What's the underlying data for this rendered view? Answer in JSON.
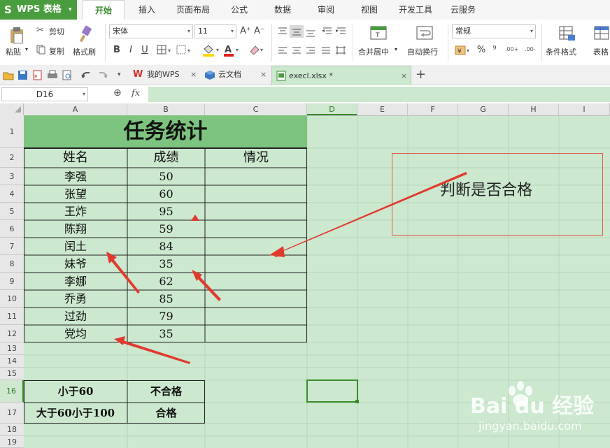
{
  "app": {
    "logo_glyph": "S",
    "name": "WPS 表格",
    "menu_arrow": "▾"
  },
  "menu_tabs": [
    "开始",
    "插入",
    "页面布局",
    "公式",
    "数据",
    "审阅",
    "视图",
    "开发工具",
    "云服务"
  ],
  "ribbon": {
    "paste": "粘贴",
    "cut": "剪切",
    "copy": "复制",
    "format_painter": "格式刷",
    "font_name": "宋体",
    "font_size": "11",
    "font_grow": "A⁺",
    "font_shrink": "A⁻",
    "bold": "B",
    "italic": "I",
    "underline": "U",
    "merge_center": "合并居中",
    "auto_wrap": "自动换行",
    "number_format": "常规",
    "percent": "%",
    "comma": "⁹",
    "inc_decimal": ".00+",
    "dec_decimal": ".00-",
    "cond_format": "条件格式",
    "table_style": "表格"
  },
  "doc_tabs": [
    {
      "label": "我的WPS"
    },
    {
      "label": "云文档"
    },
    {
      "label": "execl.xlsx *"
    }
  ],
  "formula_bar": {
    "cell_ref": "D16",
    "zoom_glyph": "⊕",
    "fx": "fx"
  },
  "columns": [
    "A",
    "B",
    "C",
    "D",
    "E",
    "F",
    "G",
    "H",
    "I"
  ],
  "rows": [
    "1",
    "2",
    "3",
    "4",
    "5",
    "6",
    "7",
    "8",
    "9",
    "10",
    "11",
    "12",
    "13",
    "14",
    "15",
    "16",
    "17",
    "18",
    "19"
  ],
  "sheet": {
    "title": "任务统计",
    "headers": [
      "姓名",
      "成绩",
      "情况"
    ],
    "records": [
      {
        "name": "李强",
        "score": "50"
      },
      {
        "name": "张望",
        "score": "60"
      },
      {
        "name": "王炸",
        "score": "95"
      },
      {
        "name": "陈翔",
        "score": "59"
      },
      {
        "name": "闰土",
        "score": "84"
      },
      {
        "name": "妹爷",
        "score": "35"
      },
      {
        "name": "李娜",
        "score": "62"
      },
      {
        "name": "乔勇",
        "score": "85"
      },
      {
        "name": "过劲",
        "score": "79"
      },
      {
        "name": "党均",
        "score": "35"
      }
    ],
    "rules": [
      {
        "condition": "小于60",
        "result": "不合格"
      },
      {
        "condition": "大于60小于100",
        "result": "合格"
      }
    ]
  },
  "annotation": {
    "text": "判断是否合格"
  },
  "watermark": {
    "brand": "Bai du 经验",
    "url": "jingyan.baidu.com"
  },
  "colors": {
    "accent": "#4a9d3f",
    "sheet_bg": "#cce8cf",
    "title_bg": "#7cc47f",
    "arrow": "#e03a2f",
    "annot_border": "#e05a4a"
  }
}
